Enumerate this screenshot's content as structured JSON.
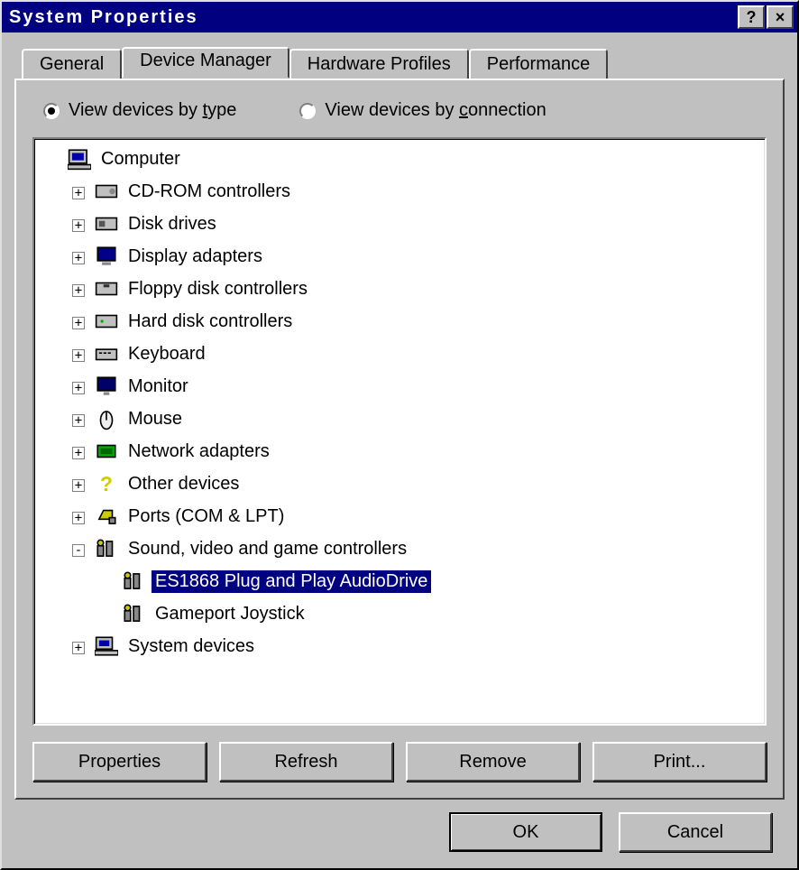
{
  "window": {
    "title": "System Properties",
    "help_glyph": "?",
    "close_glyph": "×"
  },
  "tabs": [
    {
      "label": "General",
      "active": false
    },
    {
      "label": "Device Manager",
      "active": true
    },
    {
      "label": "Hardware Profiles",
      "active": false
    },
    {
      "label": "Performance",
      "active": false
    }
  ],
  "view_mode": {
    "by_type": {
      "prefix": "View devices by ",
      "key": "t",
      "suffix": "ype",
      "selected": true
    },
    "by_connection": {
      "prefix": "View devices by ",
      "key": "c",
      "suffix": "onnection",
      "selected": false
    }
  },
  "tree": [
    {
      "depth": 0,
      "expando": "",
      "icon": "computer-icon",
      "label": "Computer",
      "selected": false
    },
    {
      "depth": 1,
      "expando": "+",
      "icon": "cdrom-icon",
      "label": "CD-ROM controllers",
      "selected": false
    },
    {
      "depth": 1,
      "expando": "+",
      "icon": "disk-icon",
      "label": "Disk drives",
      "selected": false
    },
    {
      "depth": 1,
      "expando": "+",
      "icon": "display-icon",
      "label": "Display adapters",
      "selected": false
    },
    {
      "depth": 1,
      "expando": "+",
      "icon": "floppy-icon",
      "label": "Floppy disk controllers",
      "selected": false
    },
    {
      "depth": 1,
      "expando": "+",
      "icon": "hdd-icon",
      "label": "Hard disk controllers",
      "selected": false
    },
    {
      "depth": 1,
      "expando": "+",
      "icon": "keyboard-icon",
      "label": "Keyboard",
      "selected": false
    },
    {
      "depth": 1,
      "expando": "+",
      "icon": "monitor-icon",
      "label": "Monitor",
      "selected": false
    },
    {
      "depth": 1,
      "expando": "+",
      "icon": "mouse-icon",
      "label": "Mouse",
      "selected": false
    },
    {
      "depth": 1,
      "expando": "+",
      "icon": "network-icon",
      "label": "Network adapters",
      "selected": false
    },
    {
      "depth": 1,
      "expando": "+",
      "icon": "other-icon",
      "label": "Other devices",
      "selected": false
    },
    {
      "depth": 1,
      "expando": "+",
      "icon": "port-icon",
      "label": "Ports (COM & LPT)",
      "selected": false
    },
    {
      "depth": 1,
      "expando": "-",
      "icon": "sound-icon",
      "label": "Sound, video and game controllers",
      "selected": false
    },
    {
      "depth": 2,
      "expando": "",
      "icon": "sound-icon",
      "label": "ES1868 Plug and Play AudioDrive",
      "selected": true
    },
    {
      "depth": 2,
      "expando": "",
      "icon": "sound-icon",
      "label": "Gameport Joystick",
      "selected": false
    },
    {
      "depth": 1,
      "expando": "+",
      "icon": "system-icon",
      "label": "System devices",
      "selected": false
    }
  ],
  "buttons": {
    "properties": "Properties",
    "refresh": "Refresh",
    "remove": "Remove",
    "print": "Print...",
    "ok": "OK",
    "cancel": "Cancel"
  }
}
